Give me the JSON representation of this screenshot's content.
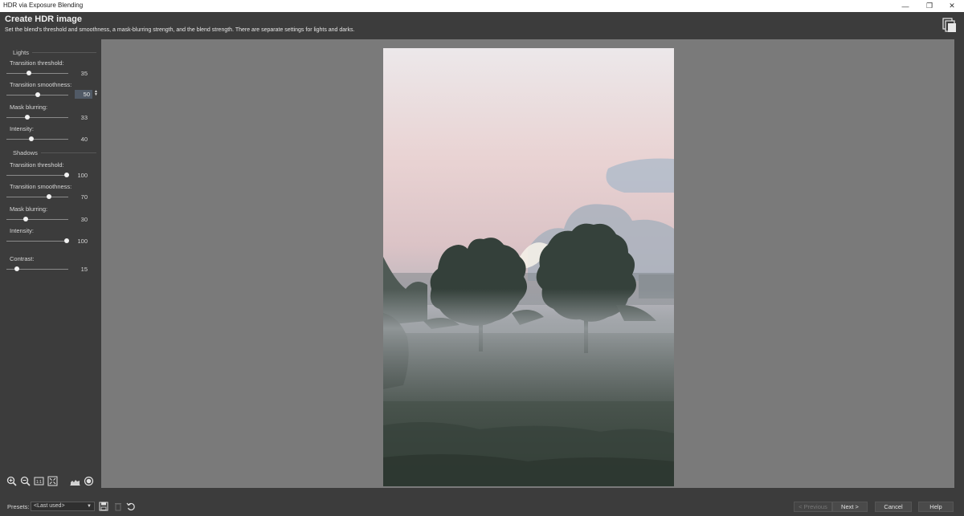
{
  "window": {
    "title": "HDR via Exposure Blending",
    "controls": {
      "minimize": "—",
      "maximize": "❐",
      "close": "✕"
    }
  },
  "header": {
    "title": "Create HDR image",
    "subtitle": "Set the blend's threshold and smoothness, a mask-blurring strength, and the blend strength. There are separate settings for lights and darks."
  },
  "lights": {
    "heading": "Lights",
    "controls": [
      {
        "label": "Transition threshold:",
        "value": "35",
        "fraction": 0.35
      },
      {
        "label": "Transition smoothness:",
        "value": "50",
        "fraction": 0.5
      },
      {
        "label": "Mask blurring:",
        "value": "33",
        "fraction": 0.33
      },
      {
        "label": "Intensity:",
        "value": "40",
        "fraction": 0.4
      }
    ]
  },
  "shadows": {
    "heading": "Shadows",
    "controls": [
      {
        "label": "Transition threshold:",
        "value": "100",
        "fraction": 1.0
      },
      {
        "label": "Transition smoothness:",
        "value": "70",
        "fraction": 0.7
      },
      {
        "label": "Mask blurring:",
        "value": "30",
        "fraction": 0.3
      },
      {
        "label": "Intensity:",
        "value": "100",
        "fraction": 1.0
      }
    ]
  },
  "contrast": {
    "label": "Contrast:",
    "value": "15",
    "fraction": 0.15
  },
  "toolbar_icons": [
    "zoom-in-icon",
    "zoom-out-icon",
    "actual-size-icon",
    "fit-to-window-icon",
    "histogram-icon",
    "preview-circle-icon"
  ],
  "bottom": {
    "presets_label": "Presets:",
    "presets_value": "<Last used>",
    "previous_label": "< Previous",
    "next_label": "Next >",
    "cancel_label": "Cancel",
    "help_label": "Help"
  },
  "colors": {
    "panel": "#3c3c3c",
    "canvas": "#7a7a7a",
    "accent_edit": "#515a66"
  }
}
